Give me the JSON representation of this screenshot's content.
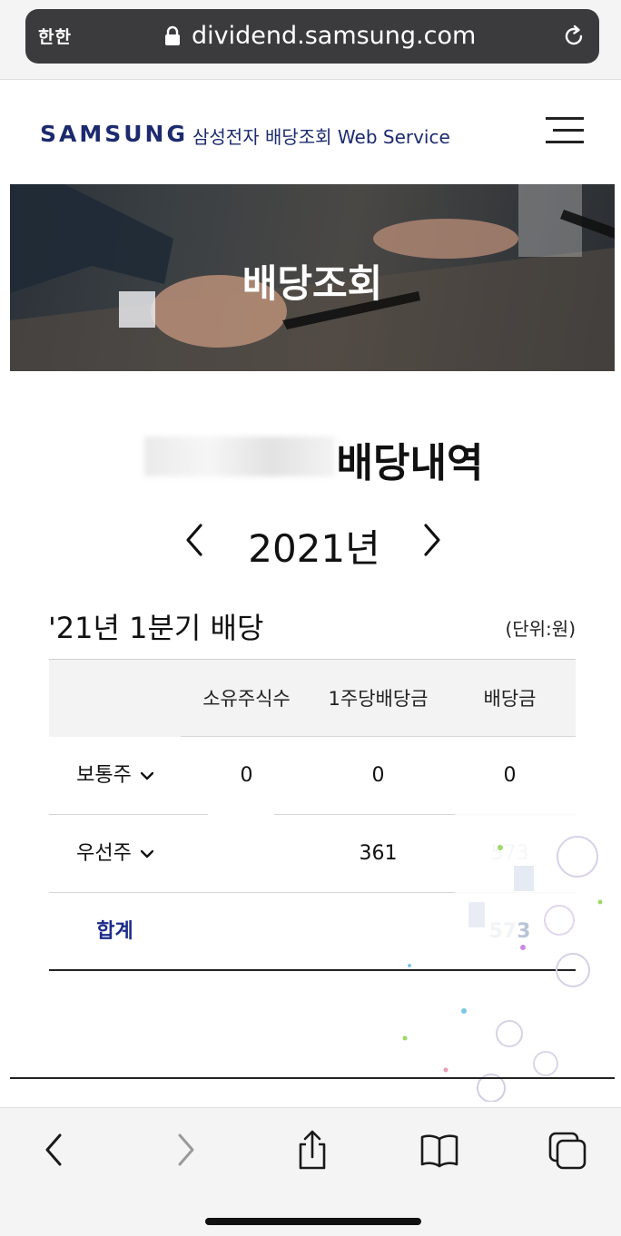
{
  "browser": {
    "aa_label": "한한",
    "url": "dividend.samsung.com",
    "icons": [
      "lock-icon",
      "reload-icon",
      "back-icon",
      "forward-icon",
      "share-icon",
      "bookmarks-icon",
      "tabs-icon"
    ]
  },
  "header": {
    "logo": "SAMSUNG",
    "service": "삼성전자 배당조회 Web Service",
    "menu_icon": "hamburger-menu-icon"
  },
  "hero": {
    "title": "배당조회"
  },
  "main": {
    "section_title": "배당내역",
    "year_label": "2021년",
    "quarter_title": "'21년 1분기 배당",
    "unit": "(단위:원)",
    "table": {
      "headers": [
        "",
        "소유주식수",
        "1주당배당금",
        "배당금"
      ],
      "rows": [
        {
          "label": "보통주",
          "shares": "0",
          "per_share": "0",
          "dividend": "0"
        },
        {
          "label": "우선주",
          "shares": "",
          "per_share": "361",
          "dividend": "573"
        }
      ],
      "total": {
        "label": "합계",
        "dividend": "573"
      }
    }
  },
  "colors": {
    "brand": "#1c2b6e",
    "total_label": "#1c2b8a",
    "table_header_bg": "#f3f3f3"
  }
}
